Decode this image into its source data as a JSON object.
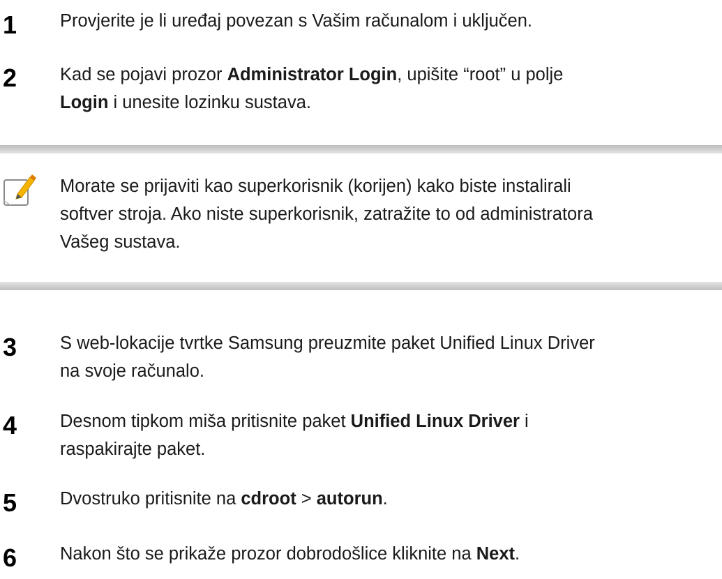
{
  "steps_a": [
    {
      "number": "1",
      "lines": [
        [
          {
            "t": "Provjerite je li uređaj povezan s Vašim računalom i uključen."
          }
        ]
      ]
    },
    {
      "number": "2",
      "lines": [
        [
          {
            "t": "Kad se pojavi prozor "
          },
          {
            "t": "Administrator Login",
            "b": true
          },
          {
            "t": ", upišite “root” u polje"
          }
        ],
        [
          {
            "t": "Login",
            "b": true
          },
          {
            "t": " i unesite lozinku sustava."
          }
        ]
      ]
    }
  ],
  "note": {
    "icon": "pencil-note-icon",
    "lines": [
      "Morate se prijaviti kao superkorisnik (korijen) kako biste instalirali",
      "softver stroja. Ako niste superkorisnik, zatražite to od administratora",
      "Vašeg sustava."
    ]
  },
  "steps_b": [
    {
      "number": "3",
      "lines": [
        [
          {
            "t": "S web-lokacije tvrtke Samsung preuzmite paket Unified Linux Driver"
          }
        ],
        [
          {
            "t": "na svoje računalo."
          }
        ]
      ]
    },
    {
      "number": "4",
      "lines": [
        [
          {
            "t": "Desnom tipkom miša pritisnite paket "
          },
          {
            "t": "Unified Linux Driver",
            "b": true
          },
          {
            "t": " i"
          }
        ],
        [
          {
            "t": "raspakirajte paket."
          }
        ]
      ]
    },
    {
      "number": "5",
      "lines": [
        [
          {
            "t": "Dvostruko pritisnite na "
          },
          {
            "t": "cdroot",
            "b": true
          },
          {
            "t": " > "
          },
          {
            "t": "autorun",
            "b": true
          },
          {
            "t": "."
          }
        ]
      ]
    },
    {
      "number": "6",
      "lines": [
        [
          {
            "t": "Nakon što se prikaže prozor dobrodošlice kliknite na "
          },
          {
            "t": "Next",
            "b": true
          },
          {
            "t": "."
          }
        ]
      ]
    }
  ],
  "colors": {
    "text": "#1a1a1a",
    "note_bar": "#c8c8c8",
    "icon_accent": "#f4b400"
  }
}
